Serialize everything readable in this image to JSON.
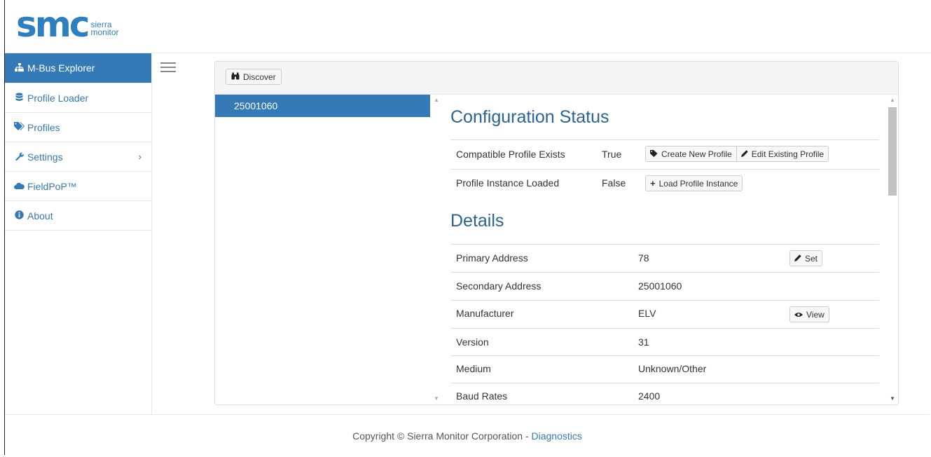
{
  "logo": {
    "mark": "smc",
    "sub_line1": "sierra",
    "sub_line2": "monitor"
  },
  "sidebar": {
    "items": [
      {
        "label": "M-Bus Explorer",
        "icon": "sitemap-icon"
      },
      {
        "label": "Profile Loader",
        "icon": "database-icon"
      },
      {
        "label": "Profiles",
        "icon": "tags-icon"
      },
      {
        "label": "Settings",
        "icon": "wrench-icon"
      },
      {
        "label": "FieldPoP™",
        "icon": "cloud-icon"
      },
      {
        "label": "About",
        "icon": "info-circle-icon"
      }
    ]
  },
  "toolbar": {
    "discover_label": "Discover"
  },
  "devices": [
    "25001060"
  ],
  "config_status": {
    "title": "Configuration Status",
    "rows": [
      {
        "label": "Compatible Profile Exists",
        "value": "True",
        "btn1": "Create New Profile",
        "btn2": "Edit Existing Profile"
      },
      {
        "label": "Profile Instance Loaded",
        "value": "False",
        "btn1": "Load Profile Instance"
      }
    ]
  },
  "details": {
    "title": "Details",
    "rows": [
      {
        "label": "Primary Address",
        "value": "78",
        "action": "Set"
      },
      {
        "label": "Secondary Address",
        "value": "25001060"
      },
      {
        "label": "Manufacturer",
        "value": "ELV",
        "action": "View"
      },
      {
        "label": "Version",
        "value": "31"
      },
      {
        "label": "Medium",
        "value": "Unknown/Other"
      },
      {
        "label": "Baud Rates",
        "value": "2400"
      }
    ]
  },
  "footer": {
    "text": "Copyright © Sierra Monitor Corporation - ",
    "link": "Diagnostics"
  },
  "colors": {
    "accent": "#337ab7",
    "heading": "#2a6496",
    "logo": "#2d7fc1"
  }
}
